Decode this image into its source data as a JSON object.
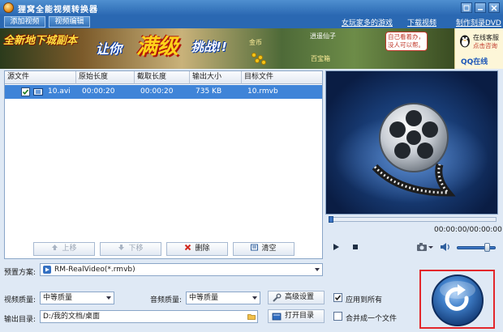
{
  "window": {
    "title": "狸窝全能视频转换器"
  },
  "tabs": {
    "add_video": "添加视频",
    "edit_video": "视频编辑"
  },
  "links": {
    "games": "女玩家多的游戏",
    "download": "下载视频",
    "dvd": "制作刻录DVD"
  },
  "banner": {
    "text1": "全新地下城副本",
    "text2": "让你",
    "text3": "满级",
    "text4": "挑战!!",
    "gold": "金币",
    "fairy": "逍遥仙子",
    "chest": "百宝箱",
    "bubble": "自己看着办，没人可以帮。"
  },
  "qq": {
    "online_service": "在线客服",
    "click_consult": "点击咨询",
    "label": "QQ在线"
  },
  "table": {
    "headers": [
      "源文件",
      "原始长度",
      "截取长度",
      "输出大小",
      "目标文件"
    ],
    "rows": [
      {
        "source": "10.avi",
        "original_length": "00:00:20",
        "clip_length": "00:00:20",
        "output_size": "735 KB",
        "target": "10.rmvb",
        "checked": true
      }
    ]
  },
  "actions": {
    "move_up": "上移",
    "move_down": "下移",
    "delete": "删除",
    "clear": "清空"
  },
  "player": {
    "time": "00:00:00/00:00:00",
    "volume": 0.85,
    "progress": 0.0
  },
  "settings": {
    "preset_label": "预置方案:",
    "preset_value": "RM-RealVideo(*.rmvb)",
    "video_quality_label": "视频质量:",
    "video_quality_value": "中等质量",
    "audio_quality_label": "音频质量:",
    "audio_quality_value": "中等质量",
    "advanced_button": "高级设置",
    "apply_all": "应用到所有",
    "apply_all_checked": true,
    "output_dir_label": "输出目录:",
    "output_dir_value": "D:/我的文档/桌面",
    "open_dir_button": "打开目录",
    "merge_label": "合并成一个文件",
    "merge_checked": false
  },
  "colors": {
    "titlebar": "#2a68b2",
    "selection": "#3f84d8",
    "highlight_frame": "#e3272b"
  }
}
